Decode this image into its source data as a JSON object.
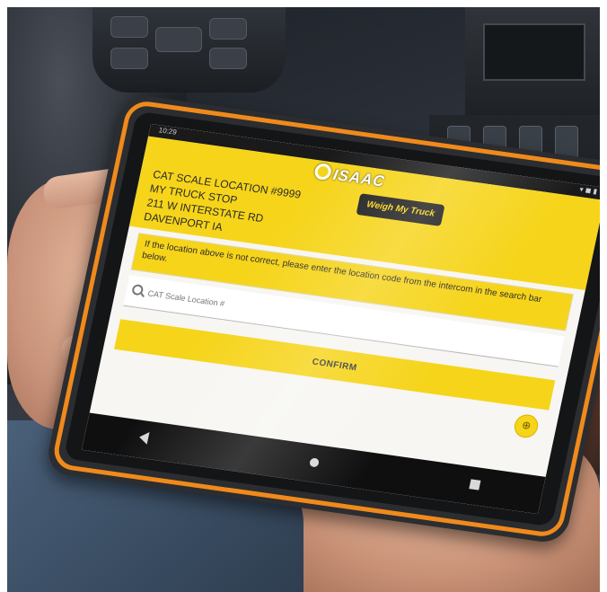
{
  "colors": {
    "accent_yellow": "#f6d419",
    "case_orange": "#f08a1c"
  },
  "tablet": {
    "status_time": "10:29",
    "status_icons": "▾ ◼ ▮",
    "logo_text": "ISAAC",
    "logo_mark_icon": "isaac-circle-logo",
    "brand_text": "Weigh My Truck",
    "location": {
      "line1": "CAT SCALE LOCATION #9999",
      "line2": "MY TRUCK STOP",
      "line3": "211 W INTERSTATE RD",
      "line4": "DAVENPORT IA"
    },
    "notice": "If the location above is not correct, please enter the location code from the intercom in the search bar below.",
    "search": {
      "icon": "search-icon",
      "placeholder": "CAT Scale Location #"
    },
    "confirm_label": "CONFIRM",
    "fab_icon": "target-icon",
    "fab_glyph": "⊕",
    "nav": {
      "back_icon": "back-icon",
      "home_icon": "home-icon",
      "recent_icon": "recent-apps-icon"
    }
  }
}
